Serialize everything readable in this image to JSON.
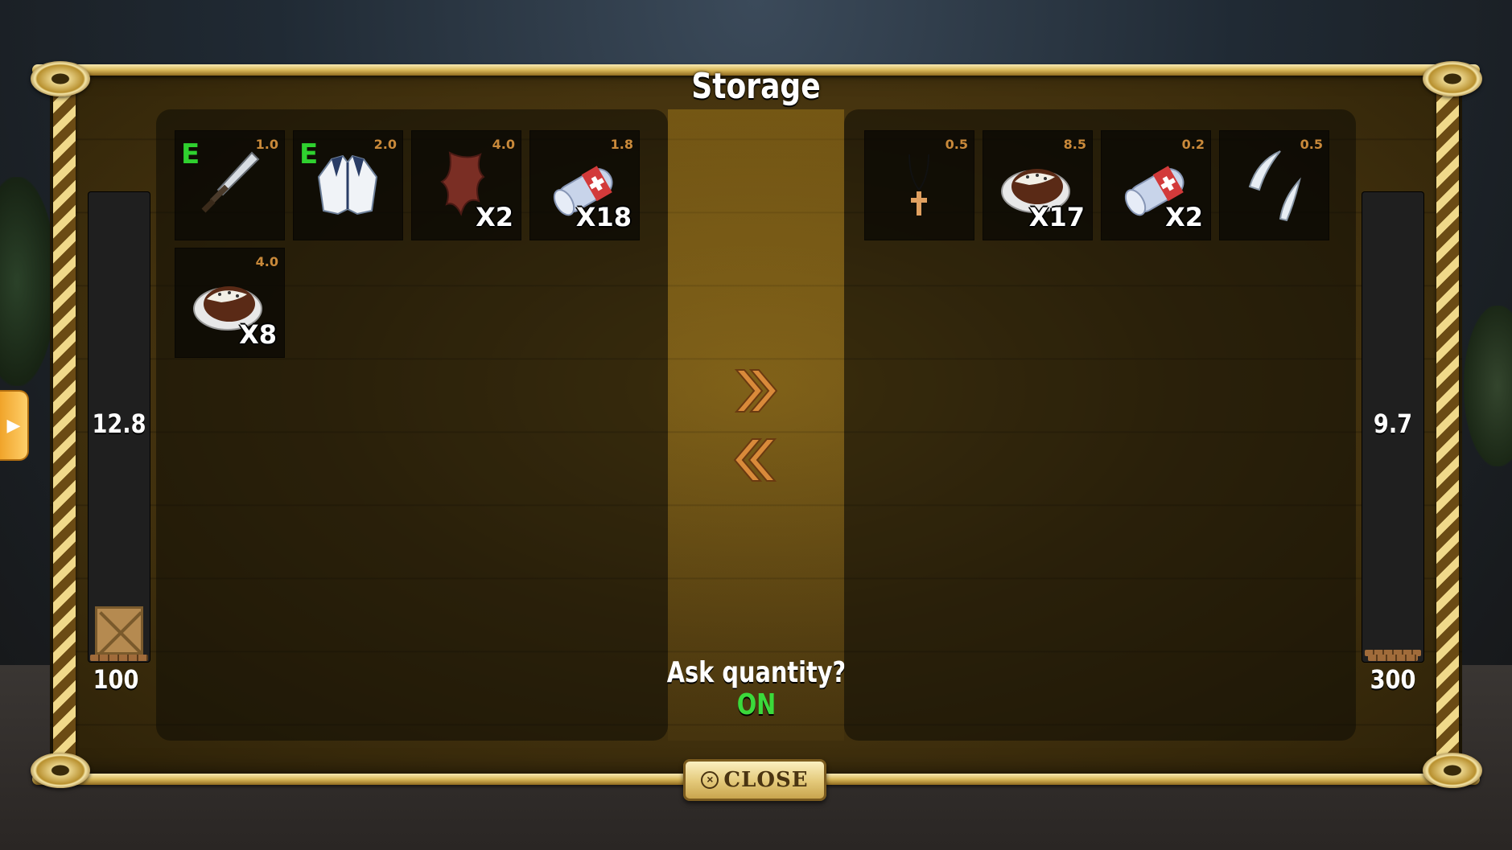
{
  "window": {
    "title": "Storage"
  },
  "inventory": {
    "weight_current": "12.8",
    "weight_max": "100",
    "items": [
      {
        "name": "sword",
        "icon": "sword-icon",
        "weight": "1.0",
        "equipped": "E",
        "qty": ""
      },
      {
        "name": "jacket",
        "icon": "jacket-icon",
        "weight": "2.0",
        "equipped": "E",
        "qty": ""
      },
      {
        "name": "fur",
        "icon": "fur-icon",
        "weight": "4.0",
        "equipped": "",
        "qty": "X2"
      },
      {
        "name": "bandage",
        "icon": "bandage-icon",
        "weight": "1.8",
        "equipped": "",
        "qty": "X18"
      },
      {
        "name": "meat",
        "icon": "meat-icon",
        "weight": "4.0",
        "equipped": "",
        "qty": "X8"
      }
    ]
  },
  "storage": {
    "weight_current": "9.7",
    "weight_max": "300",
    "items": [
      {
        "name": "necklace",
        "icon": "cross-necklace-icon",
        "weight": "0.5",
        "equipped": "",
        "qty": ""
      },
      {
        "name": "meat",
        "icon": "meat-icon",
        "weight": "8.5",
        "equipped": "",
        "qty": "X17"
      },
      {
        "name": "bandage",
        "icon": "bandage-icon",
        "weight": "0.2",
        "equipped": "",
        "qty": "X2"
      },
      {
        "name": "fangs",
        "icon": "fangs-icon",
        "weight": "0.5",
        "equipped": "",
        "qty": ""
      }
    ]
  },
  "controls": {
    "ask_quantity_label": "Ask quantity?",
    "ask_quantity_value": "ON",
    "close_label": "CLOSE"
  },
  "colors": {
    "equipped": "#2fd12f",
    "weight": "#c9893a",
    "toggle_on": "#3bd93b",
    "arrow": "#d98a3a"
  }
}
